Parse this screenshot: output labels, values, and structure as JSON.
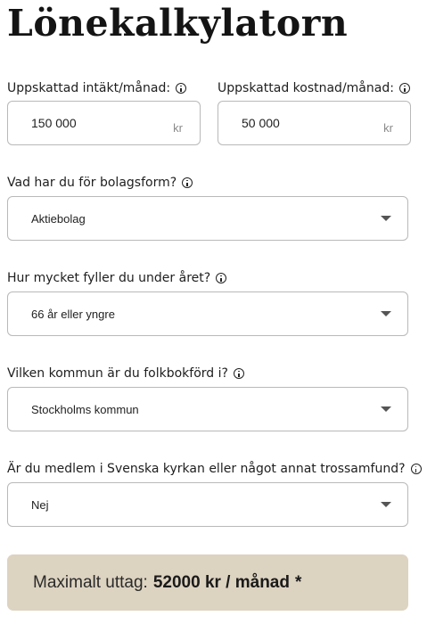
{
  "header": {
    "title": "Lönekalkylatorn"
  },
  "income": {
    "label": "Uppskattad intäkt/månad:",
    "value": "150 000",
    "unit": "kr"
  },
  "cost": {
    "label": "Uppskattad kostnad/månad:",
    "value": "50 000",
    "unit": "kr"
  },
  "company_form": {
    "label": "Vad har du för bolagsform?",
    "value": "Aktiebolag"
  },
  "age": {
    "label": "Hur mycket fyller du under året?",
    "value": "66 år eller yngre"
  },
  "municipality": {
    "label": "Vilken kommun är du folkbokförd i?",
    "value": "Stockholms kommun"
  },
  "church": {
    "label": "Är du medlem i Svenska kyrkan eller något annat trossamfund?",
    "value": "Nej"
  },
  "result": {
    "prefix": "Maximalt uttag:",
    "amount": "52000 kr / månad",
    "note": "*"
  }
}
